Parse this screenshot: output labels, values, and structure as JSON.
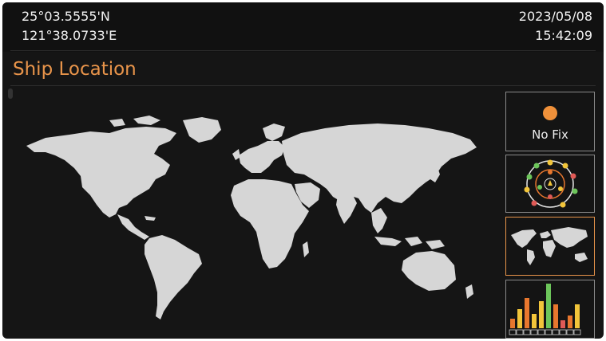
{
  "header": {
    "latitude": "25°03.5555'N",
    "longitude": "121°38.0733'E",
    "date": "2023/05/08",
    "time": "15:42:09"
  },
  "page": {
    "title": "Ship Location"
  },
  "sidebar": {
    "gps_status": {
      "label": "No Fix",
      "indicator_color": "#f0913a"
    },
    "items": [
      {
        "icon": "gps-status-icon"
      },
      {
        "icon": "satellite-skyview-icon"
      },
      {
        "icon": "world-map-icon",
        "selected": true
      },
      {
        "icon": "signal-strength-bars-icon"
      }
    ]
  },
  "colors": {
    "accent": "#e8944a",
    "background": "#151515",
    "land": "#d6d6d6",
    "signal_green": "#6cc55a",
    "signal_yellow": "#f2c53a",
    "signal_orange": "#e8772e",
    "signal_red": "#e05a56"
  }
}
